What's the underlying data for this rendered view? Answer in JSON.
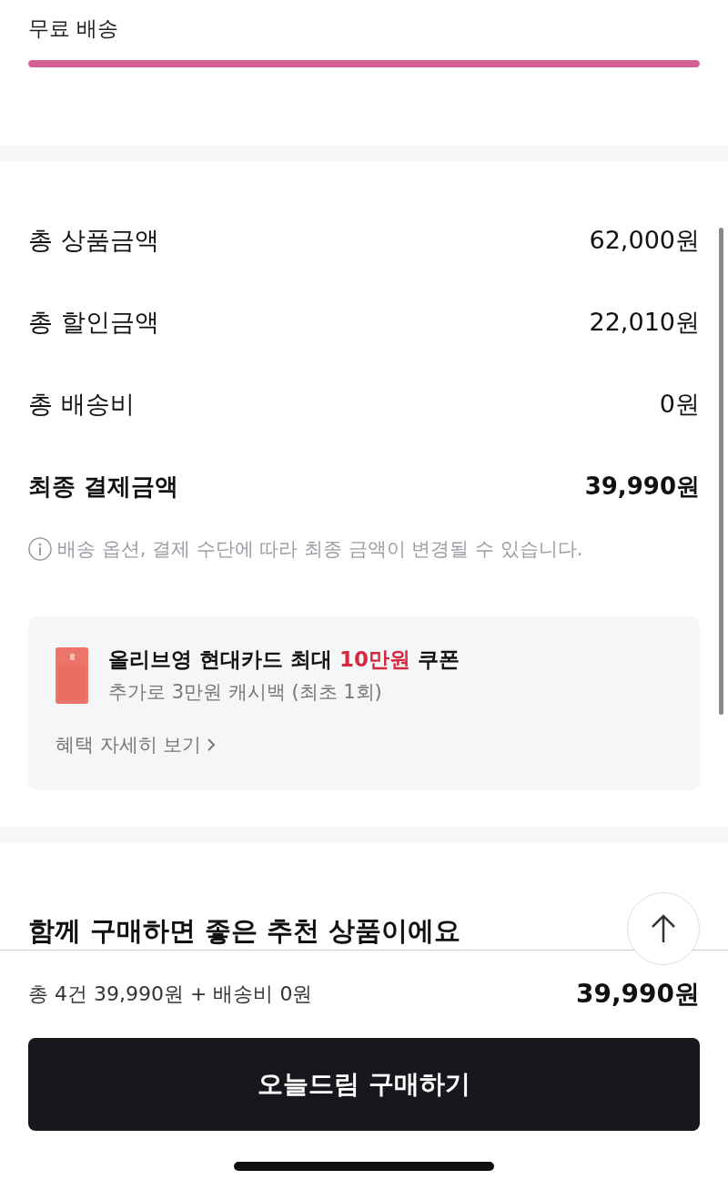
{
  "free_shipping": {
    "label": "무료 배송",
    "level": 1
  },
  "summary": {
    "rows": [
      {
        "label": "총 상품금액",
        "value": "62,000원",
        "kind": "normal"
      },
      {
        "label": "총 할인금액",
        "value": "22,010원",
        "kind": "normal"
      },
      {
        "label": "총 배송비",
        "value": "0원",
        "kind": "normal"
      },
      {
        "label": "최종 결제금액",
        "value": "39,990원",
        "kind": "total"
      }
    ],
    "notice": "배송 옵션, 결제 수단에 따라 최종 금액이 변경될 수 있습니다."
  },
  "promo": {
    "title": "올리브영 현대카드 최대 **10만원** 쿠폰",
    "subtitle": "추가로 3만원 캐시백 (최초 1회)",
    "link": "혜택 자세히 보기"
  },
  "recommend": {
    "heading": "함께 구매하면 좋은 추천 상품이에요"
  },
  "bottom_bar": {
    "breakdown": "총 4건 39,990원 + 배송비 0원",
    "total": "39,990원",
    "button": "오늘드림 구매하기"
  }
}
